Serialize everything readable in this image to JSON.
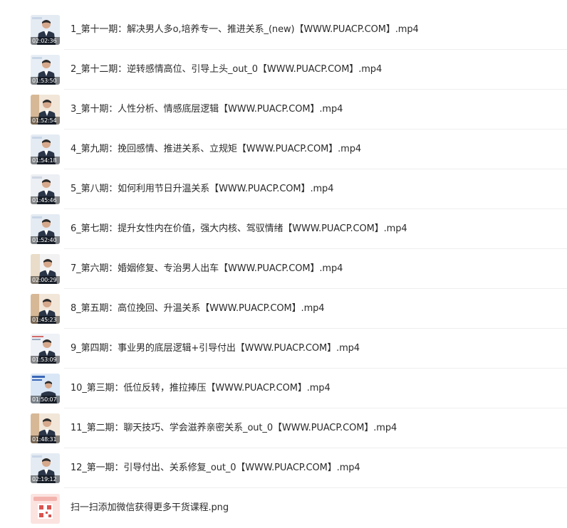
{
  "files": [
    {
      "name": "1_第十一期：解决男人多o,培养专一、推进关系_(new)【WWW.PUACP.COM】.mp4",
      "duration": "02:02:36",
      "type": "video"
    },
    {
      "name": "2_第十二期：逆转感情高位、引导上头_out_0【WWW.PUACP.COM】.mp4",
      "duration": "01:53:50",
      "type": "video"
    },
    {
      "name": "3_第十期：人性分析、情感底层逻辑【WWW.PUACP.COM】.mp4",
      "duration": "01:52:54",
      "type": "video"
    },
    {
      "name": "4_第九期：挽回感情、推进关系、立规矩【WWW.PUACP.COM】.mp4",
      "duration": "01:54:18",
      "type": "video"
    },
    {
      "name": "5_第八期：如何利用节日升温关系【WWW.PUACP.COM】.mp4",
      "duration": "01:45:46",
      "type": "video"
    },
    {
      "name": "6_第七期：提升女性内在价值，强大内核、驾驭情绪【WWW.PUACP.COM】.mp4",
      "duration": "01:52:40",
      "type": "video"
    },
    {
      "name": "7_第六期：婚姻修复、专治男人出车【WWW.PUACP.COM】.mp4",
      "duration": "02:00:29",
      "type": "video"
    },
    {
      "name": "8_第五期：高位挽回、升温关系【WWW.PUACP.COM】.mp4",
      "duration": "01:45:23",
      "type": "video"
    },
    {
      "name": "9_第四期：事业男的底层逻辑+引导付出【WWW.PUACP.COM】.mp4",
      "duration": "01:53:09",
      "type": "video"
    },
    {
      "name": "10_第三期：低位反转，推拉捧压【WWW.PUACP.COM】.mp4",
      "duration": "01:50:07",
      "type": "video"
    },
    {
      "name": "11_第二期：聊天技巧、学会滋养亲密关系_out_0【WWW.PUACP.COM】.mp4",
      "duration": "01:48:31",
      "type": "video"
    },
    {
      "name": "12_第一期：引导付出、关系修复_out_0【WWW.PUACP.COM】.mp4",
      "duration": "02:19:12",
      "type": "video"
    },
    {
      "name": "扫一扫添加微信获得更多干货课程.png",
      "duration": "",
      "type": "image"
    }
  ],
  "colors": {
    "divider": "#eeeeee",
    "text": "#2b2b2b",
    "background": "#ffffff"
  }
}
